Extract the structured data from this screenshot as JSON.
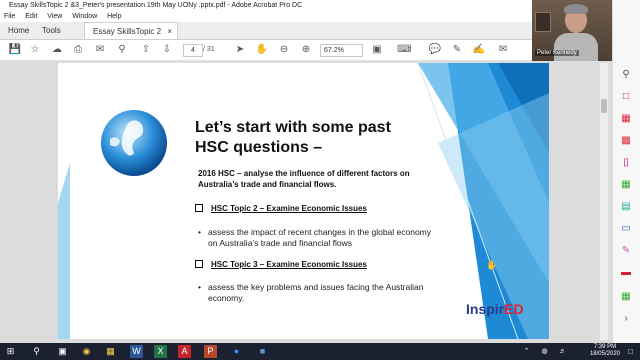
{
  "window": {
    "title": "Essay SkillsTopic 2 &3_Peter's presentation 19th May UONy .pptx.pdf - Adobe Acrobat Pro DC"
  },
  "menu": [
    "File",
    "Edit",
    "View",
    "Window",
    "Help"
  ],
  "tabs": {
    "home": "Home",
    "tools": "Tools",
    "document": "Essay SkillsTopic 2 ...",
    "close": "×"
  },
  "toolbar": {
    "page_current": "4",
    "page_total": "/ 31",
    "zoom": "67.2%"
  },
  "video": {
    "participant_name": "Peter Kennedy"
  },
  "slide": {
    "title": "Let’s  start with some past HSC questions –",
    "subtitle": "2016 HSC – analyse the  influence of different factors on Australia’s  trade and financial flows.",
    "section1_heading": "HSC Topic 2 – Examine Economic Issues",
    "section1_bullet": "assess the impact of recent changes in the global economy on Australia’s trade and financial flows",
    "section2_heading": "HSC Topic 3 – Examine Economic Issues",
    "section2_bullet": "assess the key problems and  issues facing the Australian economy.",
    "logo_main": "Inspir",
    "logo_accent": "ED"
  },
  "taskbar": {
    "time": "7:39 PM",
    "date": "18/05/2020"
  },
  "colors": {
    "slide_blue": "#1e8ad6",
    "logo_blue": "#2b3a8f",
    "logo_red": "#e2232a",
    "taskbar": "#1b2130"
  }
}
